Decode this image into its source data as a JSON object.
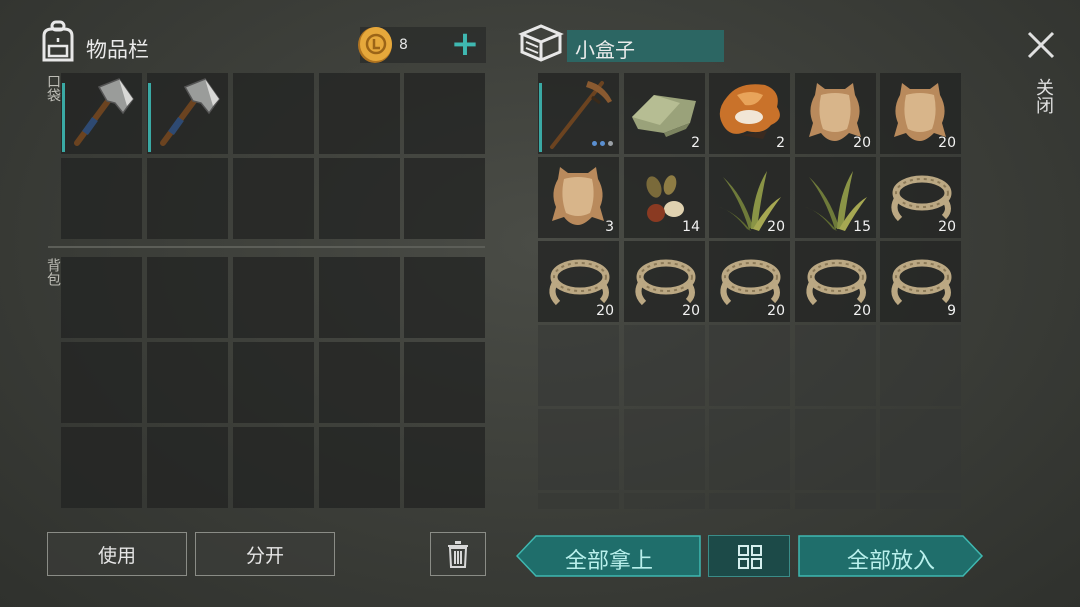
{
  "inventory": {
    "title": "物品栏",
    "pocket_label": "口袋",
    "backpack_label": "背包",
    "coins": {
      "amount": "8",
      "add_label": "+"
    },
    "pocket_slots": [
      {
        "item": "hatchet-icon",
        "count": ""
      },
      {
        "item": "hatchet-icon",
        "count": ""
      },
      {
        "item": "",
        "count": ""
      },
      {
        "item": "",
        "count": ""
      },
      {
        "item": "",
        "count": ""
      },
      {
        "item": "",
        "count": ""
      },
      {
        "item": "",
        "count": ""
      },
      {
        "item": "",
        "count": ""
      },
      {
        "item": "",
        "count": ""
      },
      {
        "item": "",
        "count": ""
      }
    ],
    "backpack_rows": 3,
    "buttons": {
      "use": "使用",
      "split": "分开"
    }
  },
  "container": {
    "title": "小盒子",
    "slots": [
      {
        "item": "pickaxe-icon",
        "count": ""
      },
      {
        "item": "cloth-icon",
        "count": "2"
      },
      {
        "item": "fox-fur-icon",
        "count": "2"
      },
      {
        "item": "leather-hide-icon",
        "count": "20"
      },
      {
        "item": "leather-hide-icon",
        "count": "20"
      },
      {
        "item": "leather-hide-icon",
        "count": "3"
      },
      {
        "item": "seeds-icon",
        "count": "14"
      },
      {
        "item": "plant-fiber-icon",
        "count": "20"
      },
      {
        "item": "plant-fiber-icon",
        "count": "15"
      },
      {
        "item": "rope-icon",
        "count": "20"
      },
      {
        "item": "rope-icon",
        "count": "20"
      },
      {
        "item": "rope-icon",
        "count": "20"
      },
      {
        "item": "rope-icon",
        "count": "20"
      },
      {
        "item": "rope-icon",
        "count": "20"
      },
      {
        "item": "rope-icon",
        "count": "9"
      }
    ],
    "buttons": {
      "take_all": "全部拿上",
      "put_all": "全部放入"
    }
  },
  "close_label": "关闭",
  "colors": {
    "accent": "#3aa9a4",
    "teal_button": "#1f6e6b",
    "coin": "#e2a23a"
  }
}
